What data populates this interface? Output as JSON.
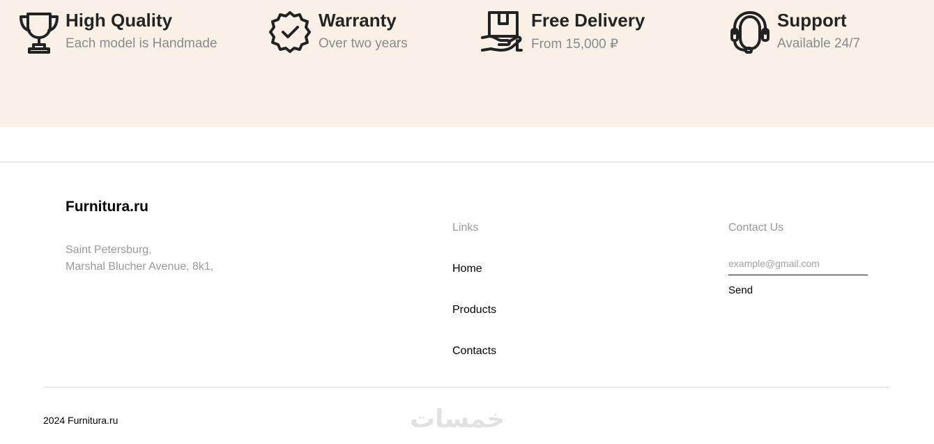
{
  "features": [
    {
      "icon": "trophy-icon",
      "title": "High Quality",
      "subtitle": "Each model is Handmade"
    },
    {
      "icon": "badge-check-icon",
      "title": "Warranty",
      "subtitle": "Over two years"
    },
    {
      "icon": "delivery-box-icon",
      "title": "Free Delivery",
      "subtitle": "From 15,000 ₽"
    },
    {
      "icon": "headset-support-icon",
      "title": "Support",
      "subtitle": "Available 24/7"
    }
  ],
  "footer": {
    "brand": "Furnitura.ru",
    "address_line1": "Saint Petersburg,",
    "address_line2": "Marshal Blucher Avenue, 8k1,",
    "links_heading": "Links",
    "links": [
      "Home",
      "Products",
      "Contacts"
    ],
    "contact_heading": "Contact Us",
    "email_placeholder": "example@gmail.com",
    "email_value": "",
    "send_label": "Send",
    "copyright": "2024 Furnitura.ru",
    "watermark": "خمسات"
  },
  "colors": {
    "features_background": "#f9f1e7",
    "heading_text": "#242424",
    "muted_text": "#8a8a8a",
    "divider": "#d6d6d6"
  }
}
